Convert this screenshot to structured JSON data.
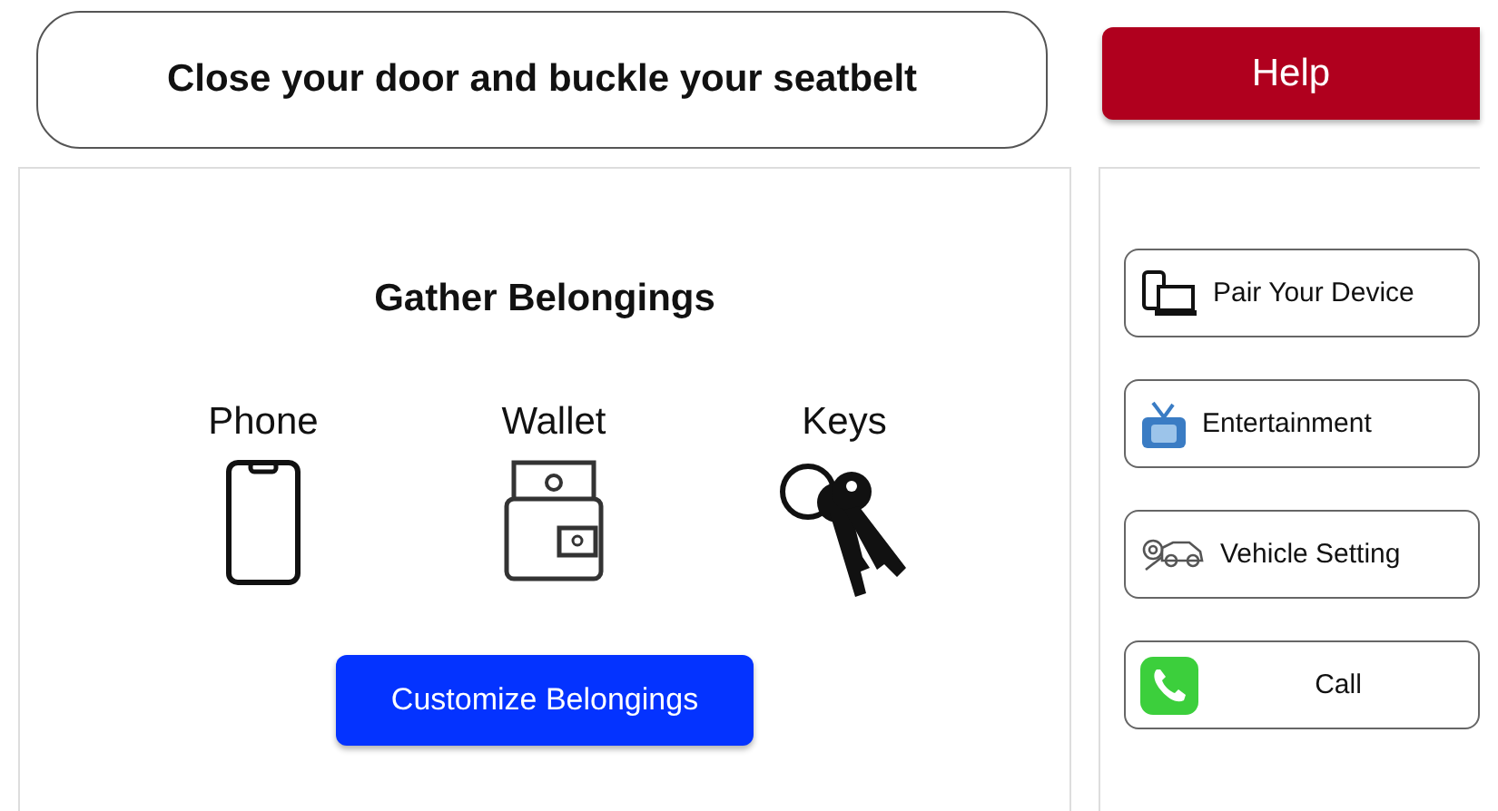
{
  "banner": {
    "message": "Close your door and buckle your seatbelt"
  },
  "help_button": {
    "label": "Help"
  },
  "belongings": {
    "title": "Gather Belongings",
    "items": [
      {
        "label": "Phone",
        "kind": "phone"
      },
      {
        "label": "Wallet",
        "kind": "wallet"
      },
      {
        "label": "Keys",
        "kind": "keys"
      }
    ],
    "button": {
      "label": "Customize Belongings"
    }
  },
  "menu": [
    {
      "label": "Pair Your Device",
      "kind": "devices"
    },
    {
      "label": "Entertainment",
      "kind": "tv"
    },
    {
      "label": "Vehicle Setting",
      "kind": "vehicle"
    },
    {
      "label": "Call",
      "kind": "call"
    }
  ]
}
